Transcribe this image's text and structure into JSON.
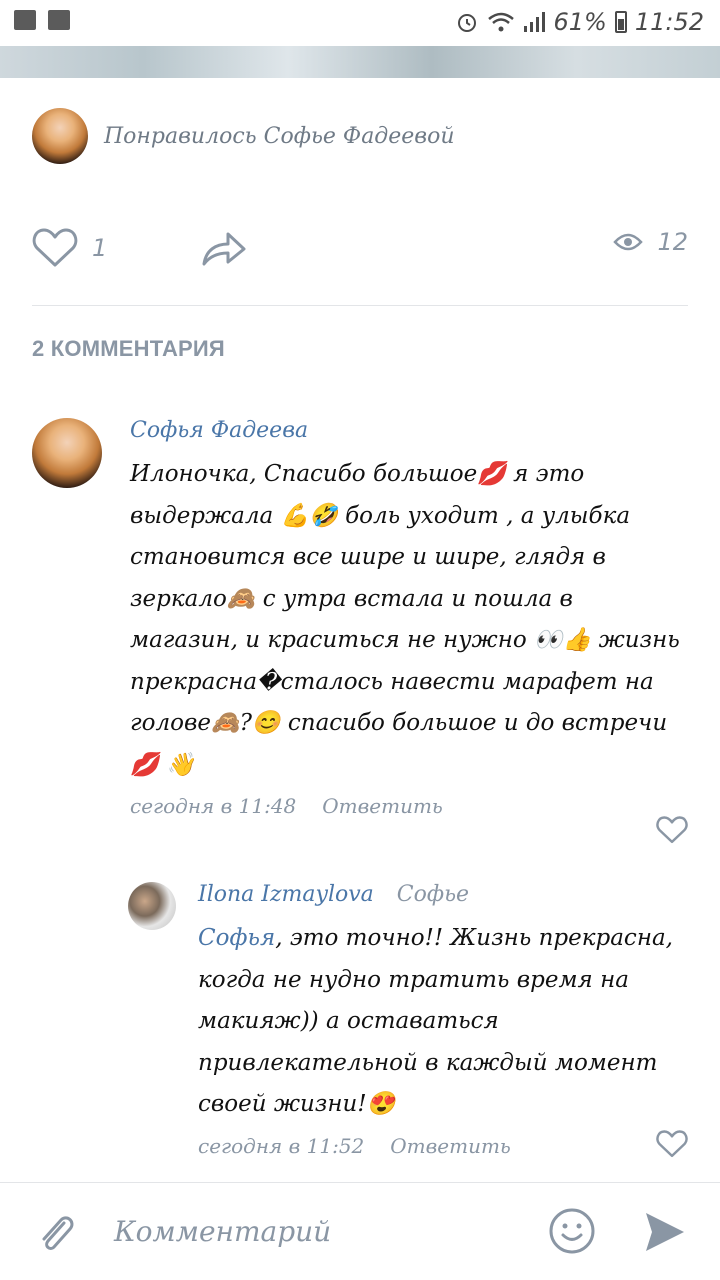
{
  "status_bar": {
    "battery": "61%",
    "time": "11:52"
  },
  "liked_by": "Понравилось Софье Фадеевой",
  "actions": {
    "likes": "1",
    "views": "12"
  },
  "comments_header": "2 КОММЕНТАРИЯ",
  "comments": [
    {
      "author": "Софья Фадеева",
      "text": "Илоночка, Спасибо большое💋 я это выдержала 💪🤣 боль уходит , а улыбка становится все шире и шире, глядя в зеркало🙈 с утра встала и пошла в магазин, и краситься не нужно 👀👍 жизнь прекрасна�сталось навести марафет на голове🙈?😊 спасибо большое и до встречи💋 👋",
      "time": "сегодня в 11:48",
      "reply": "Ответить"
    },
    {
      "author": "Ilona Izmaylova",
      "reply_to": "Софье",
      "mention": "Софья",
      "text": ", это точно!! Жизнь прекрасна, когда не нудно тратить время на макияж)) а оставаться привлекательной в каждый момент своей жизни!😍",
      "time": "сегодня в 11:52",
      "reply": "Ответить"
    }
  ],
  "composer": {
    "placeholder": "Комментарий"
  },
  "colors": {
    "accent": "#4a76a8",
    "muted": "#8a96a4"
  }
}
